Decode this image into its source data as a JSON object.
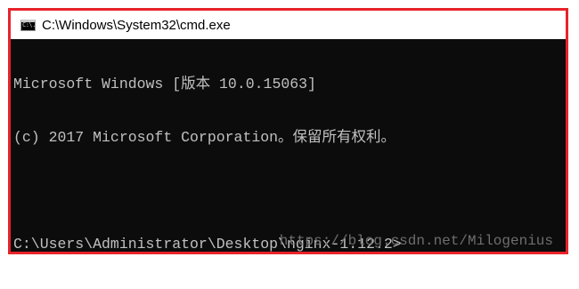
{
  "window": {
    "title": "C:\\Windows\\System32\\cmd.exe",
    "icon": "cmd-icon",
    "icon_glyph": "C:\\."
  },
  "console": {
    "lines": [
      "Microsoft Windows [版本 10.0.15063]",
      "(c) 2017 Microsoft Corporation。保留所有权利。",
      "",
      "C:\\Users\\Administrator\\Desktop\\nginx-1.12.2>"
    ]
  },
  "watermark": "https://blog.csdn.net/Milogenius",
  "colors": {
    "frame_border": "#e8232a",
    "console_background": "#0c0c0c",
    "console_text": "#c0c0c0"
  }
}
